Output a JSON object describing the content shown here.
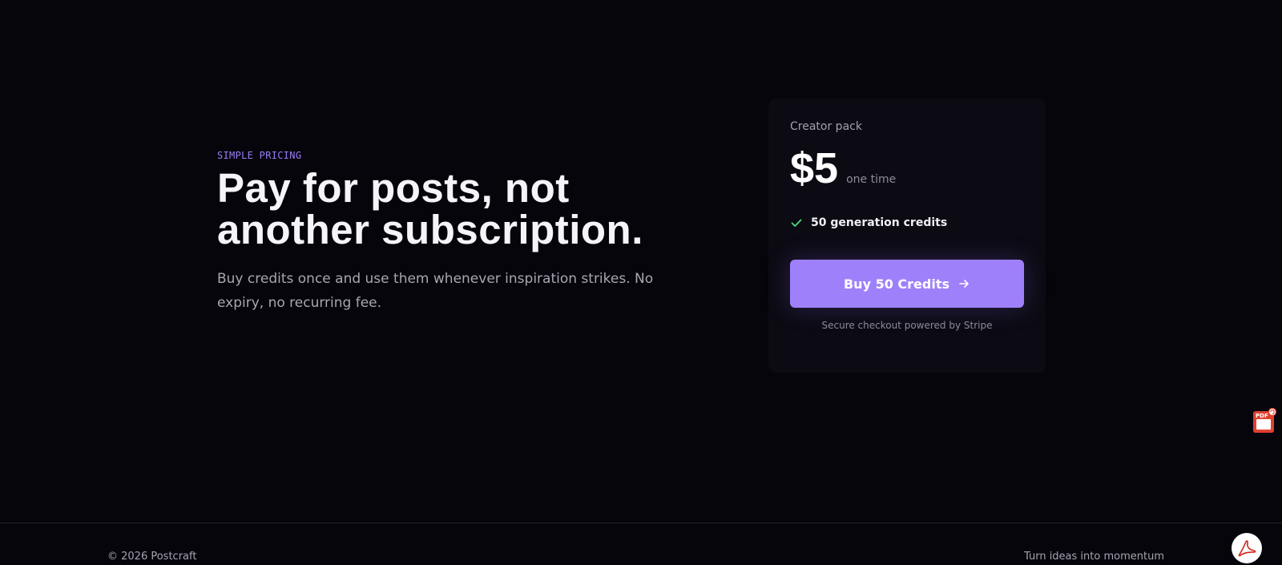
{
  "hero": {
    "eyebrow": "SIMPLE PRICING",
    "headline_line1": "Pay for posts, not",
    "headline_line2": "another subscription.",
    "subtext": "Buy credits once and use them whenever inspiration strikes. No expiry, no recurring fee."
  },
  "card": {
    "title": "Creator pack",
    "price": "$5",
    "price_note": "one time",
    "features": [
      {
        "label": "50 generation credits",
        "icon": "check-icon"
      }
    ],
    "button_label": "Buy 50 Credits",
    "button_icon": "arrow-right-icon",
    "secure_note": "Secure checkout powered by Stripe"
  },
  "footer": {
    "copyright": "© 2026 Postcraft",
    "tagline": "Turn ideas into momentum"
  },
  "widgets": {
    "pdf_badge_text": "PDF",
    "pdf_widget_icon": "pdf-export-icon",
    "pdf_round_icon": "acrobat-icon"
  },
  "colors": {
    "background": "#06050c",
    "accent": "#9f80fb",
    "eyebrow": "#9b7cf6",
    "check": "#4ade80",
    "card": "#0c0b13"
  }
}
